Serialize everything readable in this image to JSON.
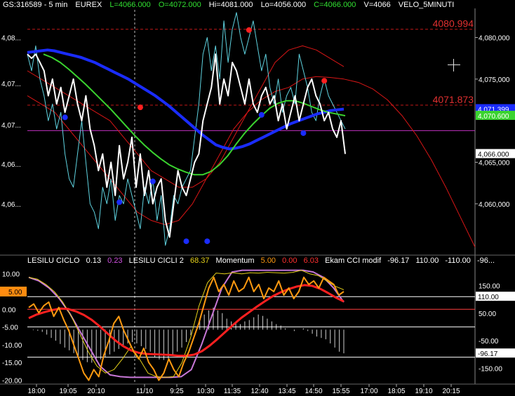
{
  "header": {
    "symbol": "GS:316589 - 5 min",
    "exchange": "EUREX",
    "last": "L=4066.000",
    "open": "O=4072.000",
    "high": "Hi=4081.000",
    "low": "Lo=4056.000",
    "close": "C=4066.000",
    "volume": "V=4066",
    "indicator": "VELO_5MINUTI"
  },
  "indicators_row": {
    "ciclo_name": "LESILU CICLO",
    "ciclo_v1": "0.13",
    "ciclo_v2": "0.23",
    "cicli2_name": "LESILU CICLI 2",
    "cicli2_v": "68.37",
    "momentum_name": "Momentum",
    "mom_v1": "5.00",
    "mom_v2": "0.00",
    "mom_v3": "6.03",
    "cci_name": "Ekam CCI modif",
    "cci_v1": "-96.17",
    "cci_v2": "110.00",
    "cci_v3": "-110.00",
    "cci_v4": "-96..."
  },
  "colors": {
    "price": "#ffffff",
    "fast": "#5fd3e0",
    "ma_blue": "#1a2cff",
    "ma_green": "#3ad32f",
    "env": "#d81616",
    "ref_magenta": "#c030c0",
    "momentum_orange": "#ff9a10",
    "cycle_yellow": "#e6d21a",
    "cycle_violet": "#c878d8",
    "hist": "#cfcfcf"
  },
  "chart_data": {
    "type": "line",
    "main_panel": {
      "y_tick_labels": [
        "4,080,000",
        "4,075,000",
        "4,065,000",
        "4,060,000"
      ],
      "y_left_labels": [
        "4,08...",
        "4,07...",
        "4,07...",
        "4,06...",
        "4,06..."
      ],
      "ylim": [
        4054,
        4083.5
      ],
      "levels": {
        "upper": {
          "label": "4080.994",
          "value": 4080.994
        },
        "middle": {
          "label": "4071.873",
          "value": 4071.873
        }
      },
      "value_tags": [
        {
          "text": "4,071.399",
          "value": 4071.399,
          "color": "#1a2cff"
        },
        {
          "text": "4,070.600",
          "value": 4070.6,
          "color": "#3ad32f"
        },
        {
          "text": "4,066.000",
          "value": 4066.0,
          "color": "#ffffff"
        }
      ],
      "ref_line_value": 4068.8,
      "close_price": [
        4078,
        4077.5,
        4078,
        4077,
        4076,
        4073,
        4075,
        4072,
        4074,
        4071,
        4073,
        4075,
        4072,
        4070,
        4073,
        4069,
        4067,
        4064,
        4066,
        4062,
        4065,
        4061,
        4067,
        4063,
        4065,
        4068,
        4062,
        4066,
        4061,
        4064,
        4060,
        4062,
        4063,
        4058,
        4056,
        4060,
        4064,
        4062,
        4061,
        4063,
        4065,
        4066,
        4070,
        4072,
        4074,
        4078,
        4072,
        4075,
        4073,
        4077,
        4076,
        4074,
        4072,
        4075,
        4072,
        4071,
        4073,
        4074,
        4072,
        4073,
        4070,
        4072,
        4069,
        4071,
        4073,
        4070,
        4072,
        4074,
        4075,
        4073,
        4072,
        4070,
        4071,
        4069,
        4068,
        4070,
        4066
      ],
      "fast_line": [
        4078,
        4076,
        4079,
        4075,
        4073,
        4070,
        4072,
        4069,
        4071,
        4066,
        4063,
        4062,
        4066,
        4070,
        4065,
        4060,
        4059,
        4057,
        4062,
        4060,
        4063,
        4058,
        4061,
        4060,
        4063,
        4061,
        4059,
        4057,
        4062,
        4060,
        4063,
        4058,
        4061,
        4055,
        4057,
        4061,
        4060,
        4062,
        4063,
        4064,
        4068,
        4072,
        4078,
        4080,
        4076,
        4079,
        4075,
        4082,
        4077,
        4081,
        4083,
        4080,
        4078,
        4080,
        4082,
        4079,
        4076,
        4078,
        4074,
        4072,
        4075,
        4071,
        4073,
        4074,
        4072,
        4078,
        4076,
        4074,
        4071,
        4070,
        4073,
        4075,
        4073,
        4072,
        4071,
        4070,
        4069
      ],
      "ma_blue": [
        4078.2,
        4078.3,
        4078.4,
        4078.5,
        4078.4,
        4078.2,
        4078.0,
        4077.8,
        4077.6,
        4077.3,
        4077.0,
        4076.6,
        4076.2,
        4075.8,
        4075.4,
        4075.0,
        4074.5,
        4074.0,
        4073.5,
        4073.0,
        4072.4,
        4071.8,
        4071.1,
        4070.4,
        4069.7,
        4069.0,
        4068.3,
        4067.7,
        4067.1,
        4066.8,
        4066.6,
        4066.7,
        4066.9,
        4067.2,
        4067.6,
        4068.0,
        4068.4,
        4068.8,
        4069.2,
        4069.6,
        4069.9,
        4070.2,
        4070.5,
        4070.8,
        4071.0,
        4071.2,
        4071.3,
        4071.4
      ],
      "ma_green": [
        4078.0,
        4077.6,
        4077.0,
        4076.2,
        4075.3,
        4074.4,
        4073.4,
        4072.4,
        4071.4,
        4070.3,
        4069.2,
        4068.1,
        4067.1,
        4066.2,
        4065.4,
        4064.7,
        4064.2,
        4063.8,
        4063.5,
        4063.5,
        4063.9,
        4064.7,
        4065.8,
        4067.2,
        4068.5,
        4069.6,
        4070.6,
        4071.5,
        4072.1,
        4072.4,
        4072.4,
        4072.1,
        4071.7,
        4071.3,
        4071.0,
        4070.8,
        4070.6
      ],
      "env_upper": [
        4076,
        4075,
        4074,
        4073,
        4072,
        4071,
        4070,
        4068,
        4066,
        4064,
        4063,
        4062,
        4062,
        4063,
        4065,
        4068,
        4071,
        4074,
        4077,
        4078.5,
        4079,
        4078.5,
        4077.5,
        4076.5
      ],
      "env_lower": [
        4073,
        4072,
        4071,
        4069,
        4067,
        4065,
        4063,
        4061,
        4059,
        4058,
        4057.5,
        4058,
        4060,
        4063,
        4066,
        4069,
        4071,
        4072.5,
        4073.5,
        4074,
        4075,
        4075.3,
        4075.2,
        4075
      ],
      "arc_tail": [
        4075,
        4074.6,
        4073.8,
        4072.5,
        4070.6,
        4068.2,
        4065.3,
        4062,
        4058.4,
        4054.8
      ],
      "dots_blue": [
        {
          "i": 9,
          "v": 4070.4
        },
        {
          "i": 22,
          "v": 4060.2
        },
        {
          "i": 30,
          "v": 4062.7
        },
        {
          "i": 38,
          "v": 4055.5
        },
        {
          "i": 43,
          "v": 4055.5
        },
        {
          "i": 56,
          "v": 4070.7
        },
        {
          "i": 66,
          "v": 4068.5
        }
      ],
      "dots_red": [
        {
          "i": 27,
          "v": 4071.6
        },
        {
          "i": 53,
          "v": 4080.9
        },
        {
          "i": 71,
          "v": 4074.8
        }
      ]
    },
    "lower_panel": {
      "left_tick_labels": [
        "10.00",
        "5.00",
        "0.00",
        "-5.00",
        "-10.00",
        "-15.00",
        "-20.00"
      ],
      "ylim_left": [
        -20.5,
        12.5
      ],
      "right_tick_labels": [
        "150.00",
        "50.00",
        "-50.00",
        "-150.00"
      ],
      "ylim_right": [
        -200,
        225
      ],
      "value_tags": [
        {
          "text": "110.00",
          "value": 110,
          "side": "right"
        },
        {
          "text": "-96.17",
          "value": -96.17,
          "side": "right"
        },
        {
          "text": "5.00",
          "value": 5,
          "side": "left"
        }
      ],
      "hlines": [
        110,
        0,
        -110
      ],
      "cci_hist": [
        -10,
        -12,
        -14,
        -18,
        -28,
        -40,
        -50,
        -62,
        -75,
        -85,
        -95,
        -110,
        -120,
        -128,
        -130,
        -125,
        -118,
        -110,
        -100,
        -90,
        -80,
        -70,
        -60,
        -55,
        -60,
        -70,
        -80,
        -90,
        -110,
        -118,
        -120,
        -115,
        -105,
        -90,
        -75,
        -55,
        -30,
        -10,
        20,
        45,
        60,
        70,
        60,
        50,
        30,
        20,
        15,
        10,
        20,
        25,
        35,
        45,
        40,
        30,
        20,
        10,
        5,
        -5,
        -10,
        -15,
        -10,
        -5,
        -15,
        -25,
        -35,
        -40,
        -45,
        -60,
        -75,
        -90,
        -96
      ],
      "momentum": [
        0.5,
        1.5,
        -1.0,
        1.0,
        2.0,
        -2.0,
        0.5,
        -3.0,
        -6.0,
        -10.0,
        -14.0,
        -18.0,
        -20.0,
        -17.0,
        -19.0,
        -13.0,
        -9.0,
        -4.0,
        -2.0,
        -6.0,
        -9.0,
        -12.0,
        -14.0,
        -11.0,
        -15.0,
        -17.0,
        -20.0,
        -18.0,
        -14.0,
        -17.0,
        -19.0,
        -15.0,
        -12.0,
        -8.0,
        -4.0,
        1.0,
        6.0,
        9.0,
        5.0,
        7.0,
        4.0,
        8.0,
        5.0,
        6.0,
        9.0,
        5.0,
        7.0,
        3.0,
        6.0,
        5.0,
        8.0,
        4.0,
        6.0,
        3.0,
        5.0,
        9.0,
        7.0,
        8.0,
        6.0,
        9.0,
        8.0,
        7.0,
        4.0,
        5.0
      ],
      "ciclo_red": [
        -2.5,
        -1.5,
        -0.8,
        -0.2,
        0.2,
        0.1,
        -0.6,
        -1.6,
        -3.0,
        -4.8,
        -6.8,
        -8.8,
        -10.4,
        -11.6,
        -12.3,
        -12.6,
        -12.7,
        -12.8,
        -12.9,
        -13.1,
        -13.1,
        -12.8,
        -11.8,
        -10.2,
        -8.3,
        -6.3,
        -4.3,
        -2.4,
        -0.8,
        0.8,
        2.3,
        3.7,
        4.8,
        5.7,
        6.4,
        6.8,
        6.6,
        5.8,
        4.6,
        3.3,
        2.2
      ],
      "cycle_yellow": [
        9.0,
        8.5,
        7.0,
        5.0,
        2.0,
        -2.0,
        -7.0,
        -12.0,
        -16.0,
        -18.0,
        -17.0,
        -14.0,
        -10.5,
        -14.0,
        -18.0,
        -19.0,
        -19.2,
        -19.0,
        -15.0,
        -8.0,
        1.0,
        7.5,
        10.2,
        10.0,
        10.3,
        10.0,
        10.3,
        10.2,
        10.4,
        10.3,
        10.2,
        10.4,
        11.0,
        10.0,
        9.5,
        8.0,
        6.5,
        5.5
      ],
      "cycle_violet": [
        9.0,
        8.0,
        6.0,
        3.0,
        -1.0,
        -6.0,
        -11.0,
        -16.0,
        -18.5,
        -19.0,
        -19.2,
        -19.2,
        -19.2,
        -19.2,
        -19.2,
        -19.0,
        -17.0,
        -10.0,
        -2.0,
        6.0,
        10.5,
        11.0,
        11.0,
        11.0,
        11.0,
        11.0,
        11.0,
        11.0,
        10.5,
        9.0,
        6.0,
        2.0
      ]
    },
    "x_tick_labels": [
      "18:00",
      "19:05",
      "20:10",
      "11/10",
      "9:25",
      "10:30",
      "11:35",
      "12:40",
      "13:45",
      "14:50",
      "15:55",
      "17:00",
      "18:05",
      "19:10",
      "20:15"
    ]
  }
}
